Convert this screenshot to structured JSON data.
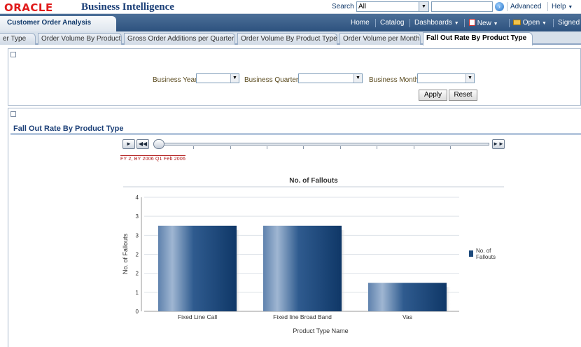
{
  "header": {
    "logo_text": "ORACLE",
    "product_name": "Business Intelligence",
    "search_label": "Search",
    "search_scope": "All",
    "advanced_label": "Advanced",
    "help_label": "Help"
  },
  "dashboard_bar": {
    "title": "Customer Order Analysis",
    "links": [
      "Home",
      "Catalog",
      "Dashboards",
      "New",
      "Open",
      "Signed"
    ]
  },
  "tabs": [
    {
      "label": "er Type",
      "active": false
    },
    {
      "label": "Order Volume By Product",
      "active": false
    },
    {
      "label": "Gross Order Additions per Quarter",
      "active": false
    },
    {
      "label": "Order Volume By Product Type",
      "active": false
    },
    {
      "label": "Order Volume per Month",
      "active": false
    },
    {
      "label": "Fall Out Rate By Product Type",
      "active": true
    }
  ],
  "prompts": {
    "business_year_label": "Business Year",
    "business_quarter_label": "Business Quarter",
    "business_month_label": "Business Month",
    "apply_label": "Apply",
    "reset_label": "Reset"
  },
  "report": {
    "title": "Fall Out Rate By Product Type",
    "slider_value": "FY 2, BY 2006 Q1  Feb 2006"
  },
  "colors": {
    "brand_red": "#e01b1b",
    "header_blue": "#2d527f",
    "bar_blue": "#1d4a7c",
    "slider_red": "#b01515"
  },
  "chart_data": {
    "type": "bar",
    "title": "No. of Fallouts",
    "xlabel": "Product Type Name",
    "ylabel": "No. of Fallouts",
    "categories": [
      "Fixed Line Call",
      "Fixed line Broad Band",
      "Vas"
    ],
    "series": [
      {
        "name": "No. of Fallouts",
        "values": [
          3,
          3,
          1
        ]
      }
    ],
    "ylim": [
      0,
      4
    ],
    "yticks": [
      "0",
      "1",
      "2",
      "2",
      "3",
      "3",
      "4"
    ],
    "grid": true,
    "legend": "right"
  }
}
